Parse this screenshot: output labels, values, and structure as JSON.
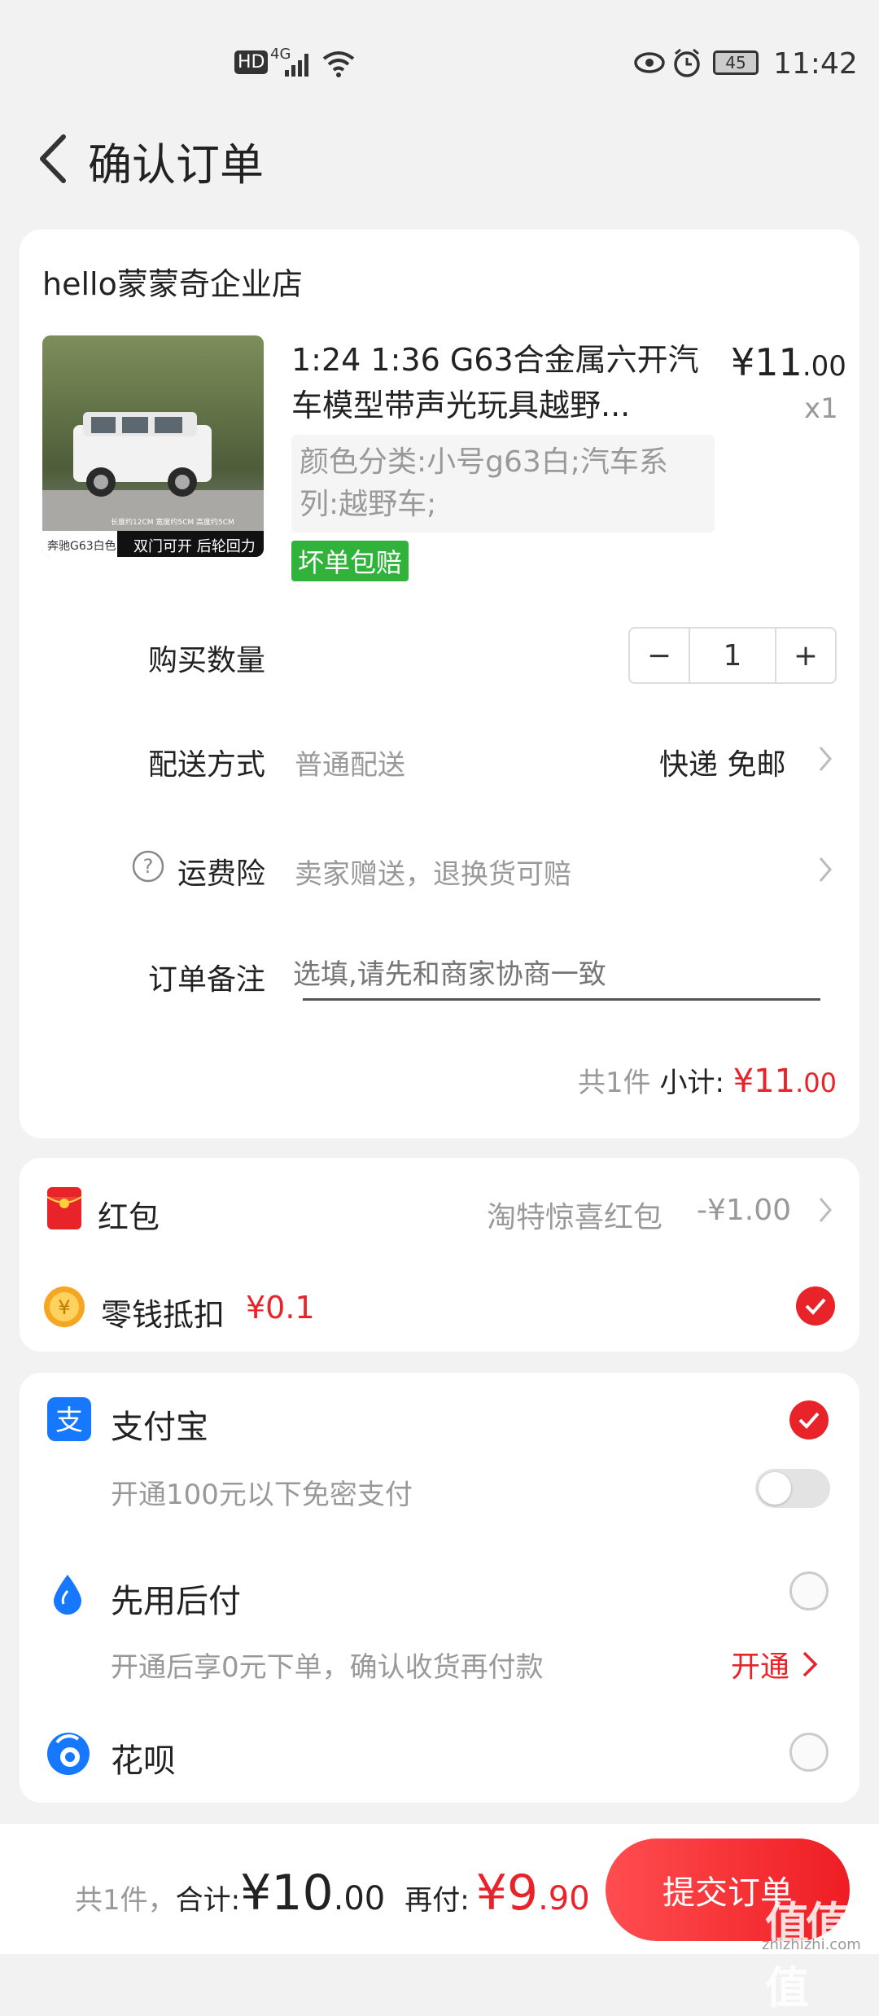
{
  "status_bar": {
    "hd": "HD",
    "network": "4G",
    "battery": "45",
    "time": "11:42"
  },
  "header": {
    "title": "确认订单"
  },
  "order": {
    "shop_name": "hello蒙蒙奇企业店",
    "product": {
      "title": "1:24 1:36 G63合金属六开汽车模型带声光玩具越野...",
      "price_int": "¥11",
      "price_dec": ".00",
      "quantity_label": "x1",
      "sku": "颜色分类:小号g63白;汽车系列:越野车;",
      "badge": "坏单包赔",
      "image_caption_left": "奔驰G63白色",
      "image_caption_right": "双门可开 后轮回力",
      "image_spec": "长度约12CM 宽度约5CM 高度约5CM"
    },
    "quantity": {
      "label": "购买数量",
      "minus": "−",
      "value": "1",
      "plus": "+"
    },
    "delivery": {
      "label": "配送方式",
      "value": "普通配送",
      "method": "快递 免邮"
    },
    "insurance": {
      "label": "运费险",
      "value": "卖家赠送，退换货可赔"
    },
    "notes": {
      "label": "订单备注",
      "placeholder": "选填,请先和商家协商一致"
    },
    "summary": {
      "count": "共1件",
      "subtotal_label": "小计:",
      "subtotal_int": "¥11",
      "subtotal_dec": ".00"
    }
  },
  "discounts": {
    "red_packet": {
      "label": "红包",
      "value": "淘特惊喜红包",
      "amount": "-¥1.00"
    },
    "change": {
      "label": "零钱抵扣",
      "amount": "¥0.1",
      "checked": true
    }
  },
  "payment": {
    "alipay": {
      "label": "支付宝",
      "sub_label": "开通100元以下免密支付",
      "checked": true,
      "toggle_on": false
    },
    "pay_later": {
      "label": "先用后付",
      "sub_label": "开通后享0元下单，确认收货再付款",
      "action": "开通",
      "checked": false
    },
    "huabei": {
      "label": "花呗",
      "checked": false
    }
  },
  "footer": {
    "count": "共1件，",
    "total_label": "合计:",
    "total_int": "¥10",
    "total_dec": ".00",
    "pay_label": "再付:",
    "pay_int": "¥9",
    "pay_dec": ".90",
    "submit": "提交订单"
  },
  "watermark": {
    "text": "值值值",
    "url": "zhizhizhi.com"
  },
  "colors": {
    "accent": "#e8242a",
    "badge_green": "#31b23a",
    "alipay_blue": "#1677ff",
    "coin_yellow": "#f5a623"
  }
}
